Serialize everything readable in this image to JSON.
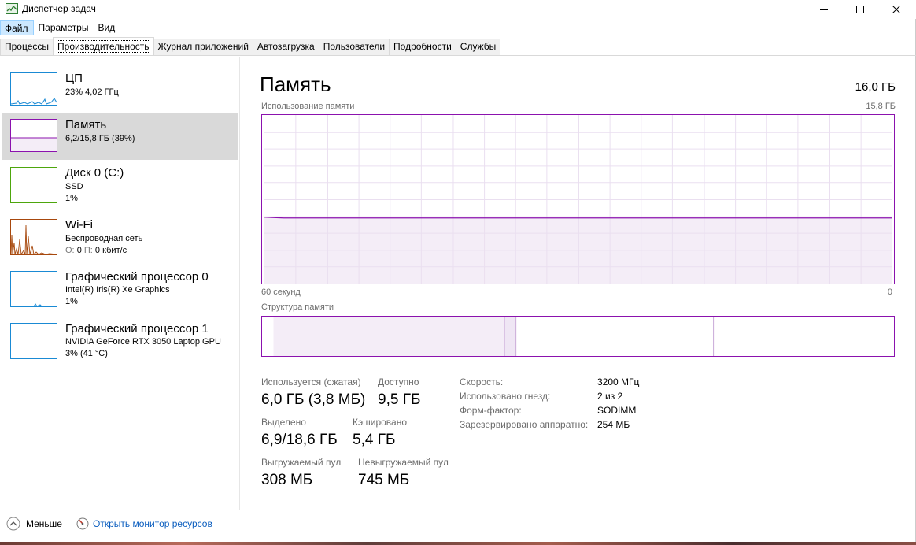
{
  "window": {
    "title": "Диспетчер задач"
  },
  "menu": [
    "Файл",
    "Параметры",
    "Вид"
  ],
  "tabs": [
    "Процессы",
    "Производительность",
    "Журнал приложений",
    "Автозагрузка",
    "Пользователи",
    "Подробности",
    "Службы"
  ],
  "active_tab": "Производительность",
  "sidebar": {
    "items": [
      {
        "title": "ЦП",
        "lines": [
          "23% 4,02 ГГц"
        ],
        "color": "#1a8ad4"
      },
      {
        "title": "Память",
        "lines": [
          "6,2/15,8 ГБ (39%)"
        ],
        "color": "#8b12ae"
      },
      {
        "title": "Диск 0 (C:)",
        "lines": [
          "SSD",
          "1%"
        ],
        "color": "#4da60c"
      },
      {
        "title": "Wi-Fi",
        "lines": [
          "Беспроводная сеть"
        ],
        "io_labels": {
          "send": "О:",
          "send_val": "0",
          "recv": "П:",
          "recv_val": "0 кбит/с"
        },
        "color": "#a7480d"
      },
      {
        "title": "Графический процессор 0",
        "lines": [
          "Intel(R) Iris(R) Xe Graphics",
          "1%"
        ],
        "color": "#1a8ad4"
      },
      {
        "title": "Графический процессор 1",
        "lines": [
          "NVIDIA GeForce RTX 3050 Laptop GPU",
          "3% (41 °C)"
        ],
        "color": "#1a8ad4"
      }
    ]
  },
  "main": {
    "title": "Память",
    "total": "16,0 ГБ",
    "usage_label": "Использование памяти",
    "usage_max": "15,8 ГБ",
    "usage_level": 0.39,
    "time_label": "60 секунд",
    "time_zero": "0",
    "structure_label": "Структура памяти",
    "accent": "#8b12ae",
    "stats": [
      {
        "label": "Используется (сжатая)",
        "value": "6,0 ГБ (3,8 МБ)"
      },
      {
        "label": "Доступно",
        "value": "9,5 ГБ"
      },
      {
        "label": "Выделено",
        "value": "6,9/18,6 ГБ"
      },
      {
        "label": "Кэшировано",
        "value": "5,4 ГБ"
      },
      {
        "label": "Выгружаемый пул",
        "value": "308 МБ"
      },
      {
        "label": "Невыгружаемый пул",
        "value": "745 МБ"
      }
    ],
    "details": [
      {
        "label": "Скорость:",
        "value": "3200 МГц"
      },
      {
        "label": "Использовано гнезд:",
        "value": "2 из 2"
      },
      {
        "label": "Форм-фактор:",
        "value": "SODIMM"
      },
      {
        "label": "Зарезервировано аппаратно:",
        "value": "254 МБ"
      }
    ]
  },
  "footer": {
    "less": "Меньше",
    "monitor": "Открыть монитор ресурсов"
  }
}
